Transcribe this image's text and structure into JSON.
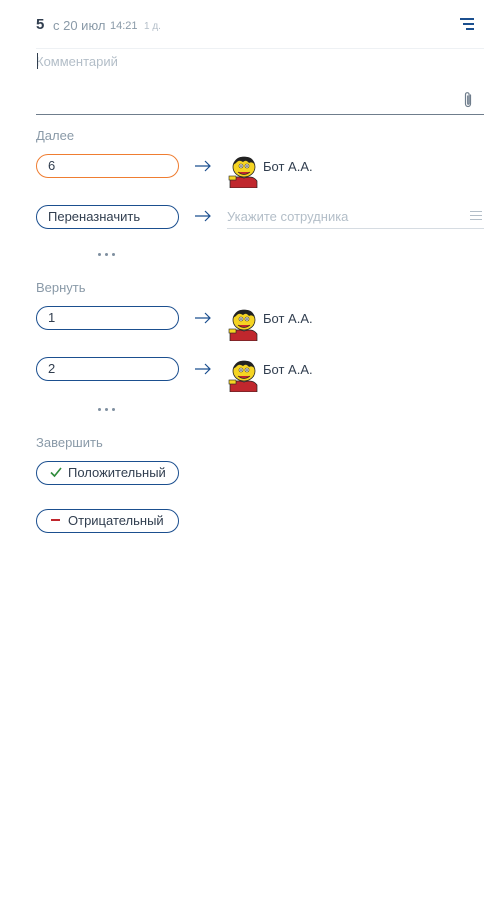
{
  "header": {
    "number": "5",
    "date": "с 20 июл",
    "time": "14:21",
    "age": "1 д."
  },
  "comment": {
    "placeholder": "Комментарий"
  },
  "next": {
    "label": "Далее",
    "step": "6",
    "assignee": "Бот А.А.",
    "reassign_label": "Переназначить",
    "employee_placeholder": "Укажите сотрудника"
  },
  "back": {
    "label": "Вернуть",
    "items": [
      {
        "step": "1",
        "assignee": "Бот А.А."
      },
      {
        "step": "2",
        "assignee": "Бот А.А."
      }
    ]
  },
  "finish": {
    "label": "Завершить",
    "positive": "Положительный",
    "negative": "Отрицательный"
  },
  "colors": {
    "accent_blue": "#1b4f8f",
    "accent_orange": "#ef7d31",
    "positive_green": "#2e8b3a",
    "negative_red": "#c0272d"
  },
  "icons": [
    "list-icon",
    "paperclip-icon",
    "arrow-right-icon",
    "hamburger-icon",
    "more-dots-icon",
    "checkmark-icon",
    "minus-icon",
    "avatar-icon"
  ]
}
